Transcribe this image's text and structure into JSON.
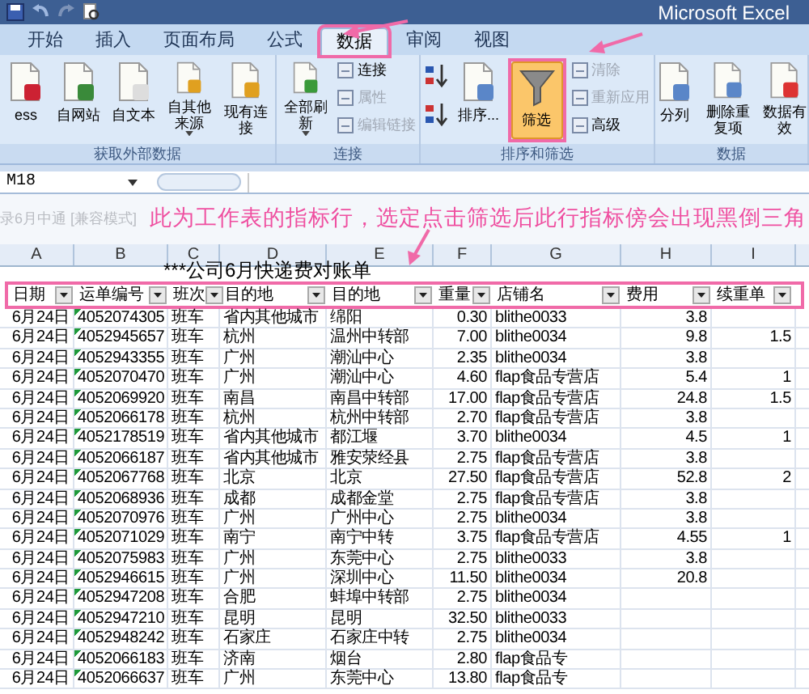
{
  "title_bar": {
    "title": "Microsoft Excel"
  },
  "tabs": [
    {
      "label": "开始",
      "selected": false,
      "annotated": false
    },
    {
      "label": "插入",
      "selected": false,
      "annotated": false
    },
    {
      "label": "页面布局",
      "selected": false,
      "annotated": false
    },
    {
      "label": "公式",
      "selected": false,
      "annotated": false
    },
    {
      "label": "数据",
      "selected": true,
      "annotated": true
    },
    {
      "label": "审阅",
      "selected": false,
      "annotated": false
    },
    {
      "label": "视图",
      "selected": false,
      "annotated": false
    }
  ],
  "ribbon": {
    "groups": [
      {
        "label": "获取外部数据",
        "items": [
          {
            "kind": "large",
            "label": "ess"
          },
          {
            "kind": "large",
            "label": "自网站"
          },
          {
            "kind": "large",
            "label": "自文本"
          },
          {
            "kind": "large",
            "label": "自其他来源",
            "dropdown": true
          },
          {
            "kind": "large",
            "label": "现有连接"
          }
        ]
      },
      {
        "label": "连接",
        "items": [
          {
            "kind": "large",
            "label": "全部刷新",
            "dropdown": true
          },
          {
            "kind": "small",
            "label": "连接",
            "disabled": false
          },
          {
            "kind": "small",
            "label": "属性",
            "disabled": true
          },
          {
            "kind": "small",
            "label": "编辑链接",
            "disabled": true
          }
        ]
      },
      {
        "label": "排序和筛选",
        "items": [
          {
            "kind": "icon"
          },
          {
            "kind": "icon"
          },
          {
            "kind": "large",
            "label": "排序..."
          },
          {
            "kind": "large",
            "label": "筛选",
            "on": true,
            "annotated": true
          },
          {
            "kind": "small",
            "label": "清除",
            "disabled": true
          },
          {
            "kind": "small",
            "label": "重新应用",
            "disabled": true
          },
          {
            "kind": "small",
            "label": "高级",
            "disabled": false
          }
        ]
      },
      {
        "label": "数据",
        "items": [
          {
            "kind": "large",
            "label": "分列"
          },
          {
            "kind": "large",
            "label": "删除重复项"
          },
          {
            "kind": "large",
            "label": "数据有效"
          }
        ]
      }
    ]
  },
  "formula_bar": {
    "name_box": "M18"
  },
  "workbook_label": "录6月中通 [兼容模式]",
  "annotation": "此为工作表的指标行，选定点击筛选后此行指标傍会出现黑倒三角",
  "sheet": {
    "columns": [
      {
        "letter": "A",
        "marked": false
      },
      {
        "letter": "B",
        "marked": true
      },
      {
        "letter": "C",
        "marked": false
      },
      {
        "letter": "D",
        "marked": false
      },
      {
        "letter": "E",
        "marked": false
      },
      {
        "letter": "F",
        "marked": false
      },
      {
        "letter": "G",
        "marked": false
      },
      {
        "letter": "H",
        "marked": false
      },
      {
        "letter": "I",
        "marked": false
      }
    ],
    "title": "***公司6月快递费对账单",
    "header": {
      "annotated": true,
      "cells": [
        "日期",
        "运单编号",
        "班次",
        "目的地",
        "目的地",
        "重量",
        "店铺名",
        "费用",
        "续重单"
      ]
    },
    "rows": [
      [
        "6月24日",
        "4052074305",
        "班车",
        "省内其他城市",
        "绵阳",
        "0.30",
        "blithe0033",
        "3.8",
        null
      ],
      [
        "6月24日",
        "4052945657",
        "班车",
        "杭州",
        "温州中转部",
        "7.00",
        "blithe0034",
        "9.8",
        "1.5"
      ],
      [
        "6月24日",
        "4052943355",
        "班车",
        "广州",
        "潮汕中心",
        "2.35",
        "blithe0034",
        "3.8",
        null
      ],
      [
        "6月24日",
        "4052070470",
        "班车",
        "广州",
        "潮汕中心",
        "4.60",
        "flap食品专营店",
        "5.4",
        "1"
      ],
      [
        "6月24日",
        "4052069920",
        "班车",
        "南昌",
        "南昌中转部",
        "17.00",
        "flap食品专营店",
        "24.8",
        "1.5"
      ],
      [
        "6月24日",
        "4052066178",
        "班车",
        "杭州",
        "杭州中转部",
        "2.70",
        "flap食品专营店",
        "3.8",
        null
      ],
      [
        "6月24日",
        "4052178519",
        "班车",
        "省内其他城市",
        "都江堰",
        "3.70",
        "blithe0034",
        "4.5",
        "1"
      ],
      [
        "6月24日",
        "4052066187",
        "班车",
        "省内其他城市",
        "雅安荥经县",
        "2.75",
        "flap食品专营店",
        "3.8",
        null
      ],
      [
        "6月24日",
        "4052067768",
        "班车",
        "北京",
        "北京",
        "27.50",
        "flap食品专营店",
        "52.8",
        "2"
      ],
      [
        "6月24日",
        "4052068936",
        "班车",
        "成都",
        "成都金堂",
        "2.75",
        "flap食品专营店",
        "3.8",
        null
      ],
      [
        "6月24日",
        "4052070976",
        "班车",
        "广州",
        "广州中心",
        "2.75",
        "blithe0034",
        "3.8",
        null
      ],
      [
        "6月24日",
        "4052071029",
        "班车",
        "南宁",
        "南宁中转",
        "3.75",
        "flap食品专营店",
        "4.55",
        "1"
      ],
      [
        "6月24日",
        "4052075983",
        "班车",
        "广州",
        "东莞中心",
        "2.75",
        "blithe0033",
        "3.8",
        null
      ],
      [
        "6月24日",
        "4052946615",
        "班车",
        "广州",
        "深圳中心",
        "11.50",
        "blithe0034",
        "20.8",
        null
      ],
      [
        "6月24日",
        "4052947208",
        "班车",
        "合肥",
        "蚌埠中转部",
        "2.75",
        "blithe0034",
        null,
        null
      ],
      [
        "6月24日",
        "4052947210",
        "班车",
        "昆明",
        "昆明",
        "32.50",
        "blithe0033",
        null,
        null
      ],
      [
        "6月24日",
        "4052948242",
        "班车",
        "石家庄",
        "石家庄中转",
        "2.75",
        "blithe0034",
        null,
        null
      ],
      [
        "6月24日",
        "4052066183",
        "班车",
        "济南",
        "烟台",
        "2.80",
        "flap食品专",
        null,
        null
      ],
      [
        "6月24日",
        "4052066637",
        "班车",
        "广州",
        "东莞中心",
        "13.80",
        "flap食品专",
        null,
        null
      ]
    ]
  }
}
